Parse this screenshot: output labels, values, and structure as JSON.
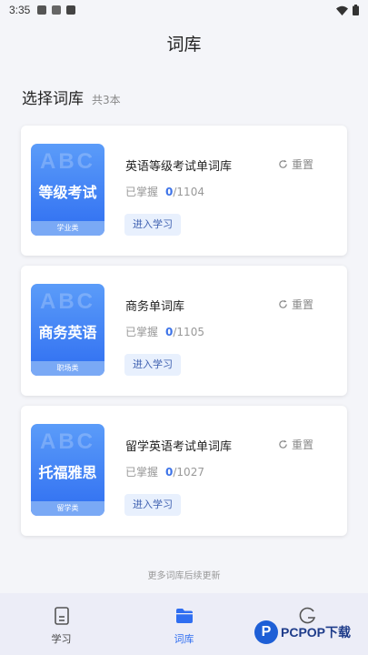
{
  "status_bar": {
    "time": "3:35"
  },
  "header": {
    "title": "词库"
  },
  "section": {
    "title": "选择词库",
    "count": "共3本"
  },
  "books": [
    {
      "cover_watermark": "ABC",
      "cover_name": "等级考试",
      "category": "学业类",
      "title": "英语等级考试单词库",
      "reset_label": "重置",
      "progress_label": "已掌握",
      "mastered": "0",
      "total": "/1104",
      "enter_label": "进入学习"
    },
    {
      "cover_watermark": "ABC",
      "cover_name": "商务英语",
      "category": "职场类",
      "title": "商务单词库",
      "reset_label": "重置",
      "progress_label": "已掌握",
      "mastered": "0",
      "total": "/1105",
      "enter_label": "进入学习"
    },
    {
      "cover_watermark": "ABC",
      "cover_name": "托福雅思",
      "category": "留学类",
      "title": "留学英语考试单词库",
      "reset_label": "重置",
      "progress_label": "已掌握",
      "mastered": "0",
      "total": "/1027",
      "enter_label": "进入学习"
    }
  ],
  "footer_note": "更多词库后续更新",
  "tabs": [
    {
      "label": "学习",
      "icon": "book-icon"
    },
    {
      "label": "词库",
      "icon": "folder-icon"
    },
    {
      "label": "",
      "icon": "g-icon"
    }
  ],
  "watermark": {
    "mark": "P",
    "text": "PCPOP下载"
  },
  "colors": {
    "accent": "#2f6ef1",
    "background": "#f4f5f9",
    "tabbar": "#ecedf7"
  }
}
